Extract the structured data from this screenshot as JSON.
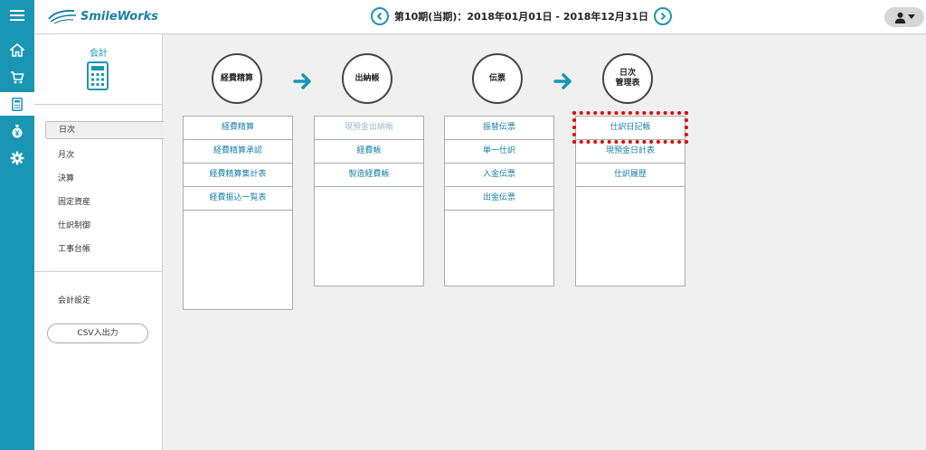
{
  "header": {
    "logo_text": "SmileWorks",
    "period": "第10期(当期)：2018年01月01日 - 2018年12月31日"
  },
  "rail_icons": [
    "menu-icon",
    "home-icon",
    "cart-icon",
    "calculator-icon",
    "yen-bag-icon",
    "gear-icon"
  ],
  "sidebar": {
    "title": "会計",
    "items": [
      "日次",
      "月次",
      "決算",
      "固定資産",
      "仕訳制御",
      "工事台帳"
    ],
    "settings": "会計設定",
    "csv_button": "CSV入出力"
  },
  "groups": [
    {
      "title": "経費精算",
      "items": [
        "経費精算",
        "経費精算承認",
        "経費精算集計表",
        "経費振込一覧表"
      ]
    },
    {
      "title": "出納帳",
      "items": [
        "現預金出納帳",
        "経費帳",
        "製造経費帳"
      ]
    },
    {
      "title": "伝票",
      "items": [
        "振替伝票",
        "単一仕訳",
        "入金伝票",
        "出金伝票"
      ]
    },
    {
      "title_line1": "日次",
      "title_line2": "管理表",
      "items": [
        "仕訳日記帳",
        "現預金日計表",
        "仕訳履歴"
      ]
    }
  ],
  "colors": {
    "accent": "#1a96b4",
    "highlight": "#e60000"
  }
}
